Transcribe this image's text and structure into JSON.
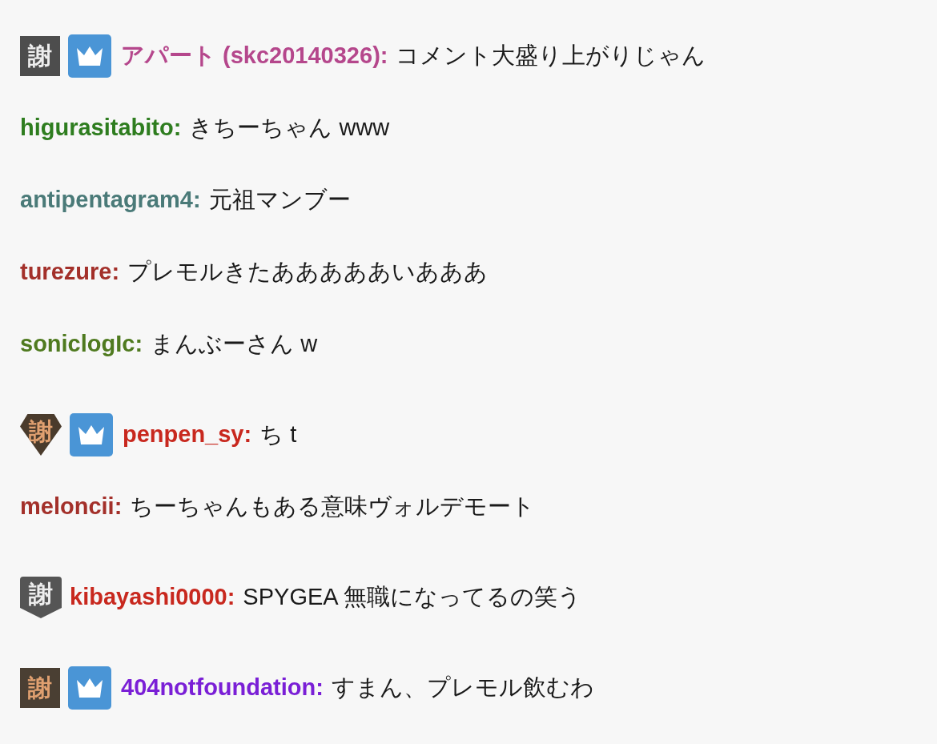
{
  "messages": [
    {
      "badges": [
        {
          "kind": "square",
          "text": "謝",
          "color": "#4d4d4d"
        },
        {
          "kind": "crown"
        }
      ],
      "user": "アパート (skc20140326):",
      "color": "#b5478c",
      "text": "コメント大盛り上がりじゃん"
    },
    {
      "user": "higurasitabito:",
      "color": "#2e7d1f",
      "text": "きちーちゃん www"
    },
    {
      "user": "antipentagram4:",
      "color": "#4a7a78",
      "text": "元祖マンブー"
    },
    {
      "user": "turezure:",
      "color": "#a3302a",
      "text": "プレモルきたあああああいあああ"
    },
    {
      "user": "soniclogIc:",
      "color": "#4f7a1f",
      "text": "まんぶーさん w"
    },
    {
      "badges": [
        {
          "kind": "gem",
          "text": "謝",
          "color": "#4a3b2c"
        },
        {
          "kind": "crown"
        }
      ],
      "user": "penpen_sy:",
      "color": "#c8281e",
      "text": "ち t"
    },
    {
      "user": "meloncii:",
      "color": "#a3302a",
      "text": "ちーちゃんもある意味ヴォルデモート"
    },
    {
      "badges": [
        {
          "kind": "shield",
          "text": "謝",
          "color": "#555555"
        }
      ],
      "user": "kibayashi0000:",
      "color": "#c8281e",
      "text": "SPYGEA 無職になってるの笑う"
    },
    {
      "badges": [
        {
          "kind": "square",
          "text": "謝",
          "color": "#4a3f33"
        },
        {
          "kind": "crown"
        }
      ],
      "user": "404notfoundation:",
      "color": "#7a1fd6",
      "text": "すまん、プレモル飲むわ"
    }
  ]
}
